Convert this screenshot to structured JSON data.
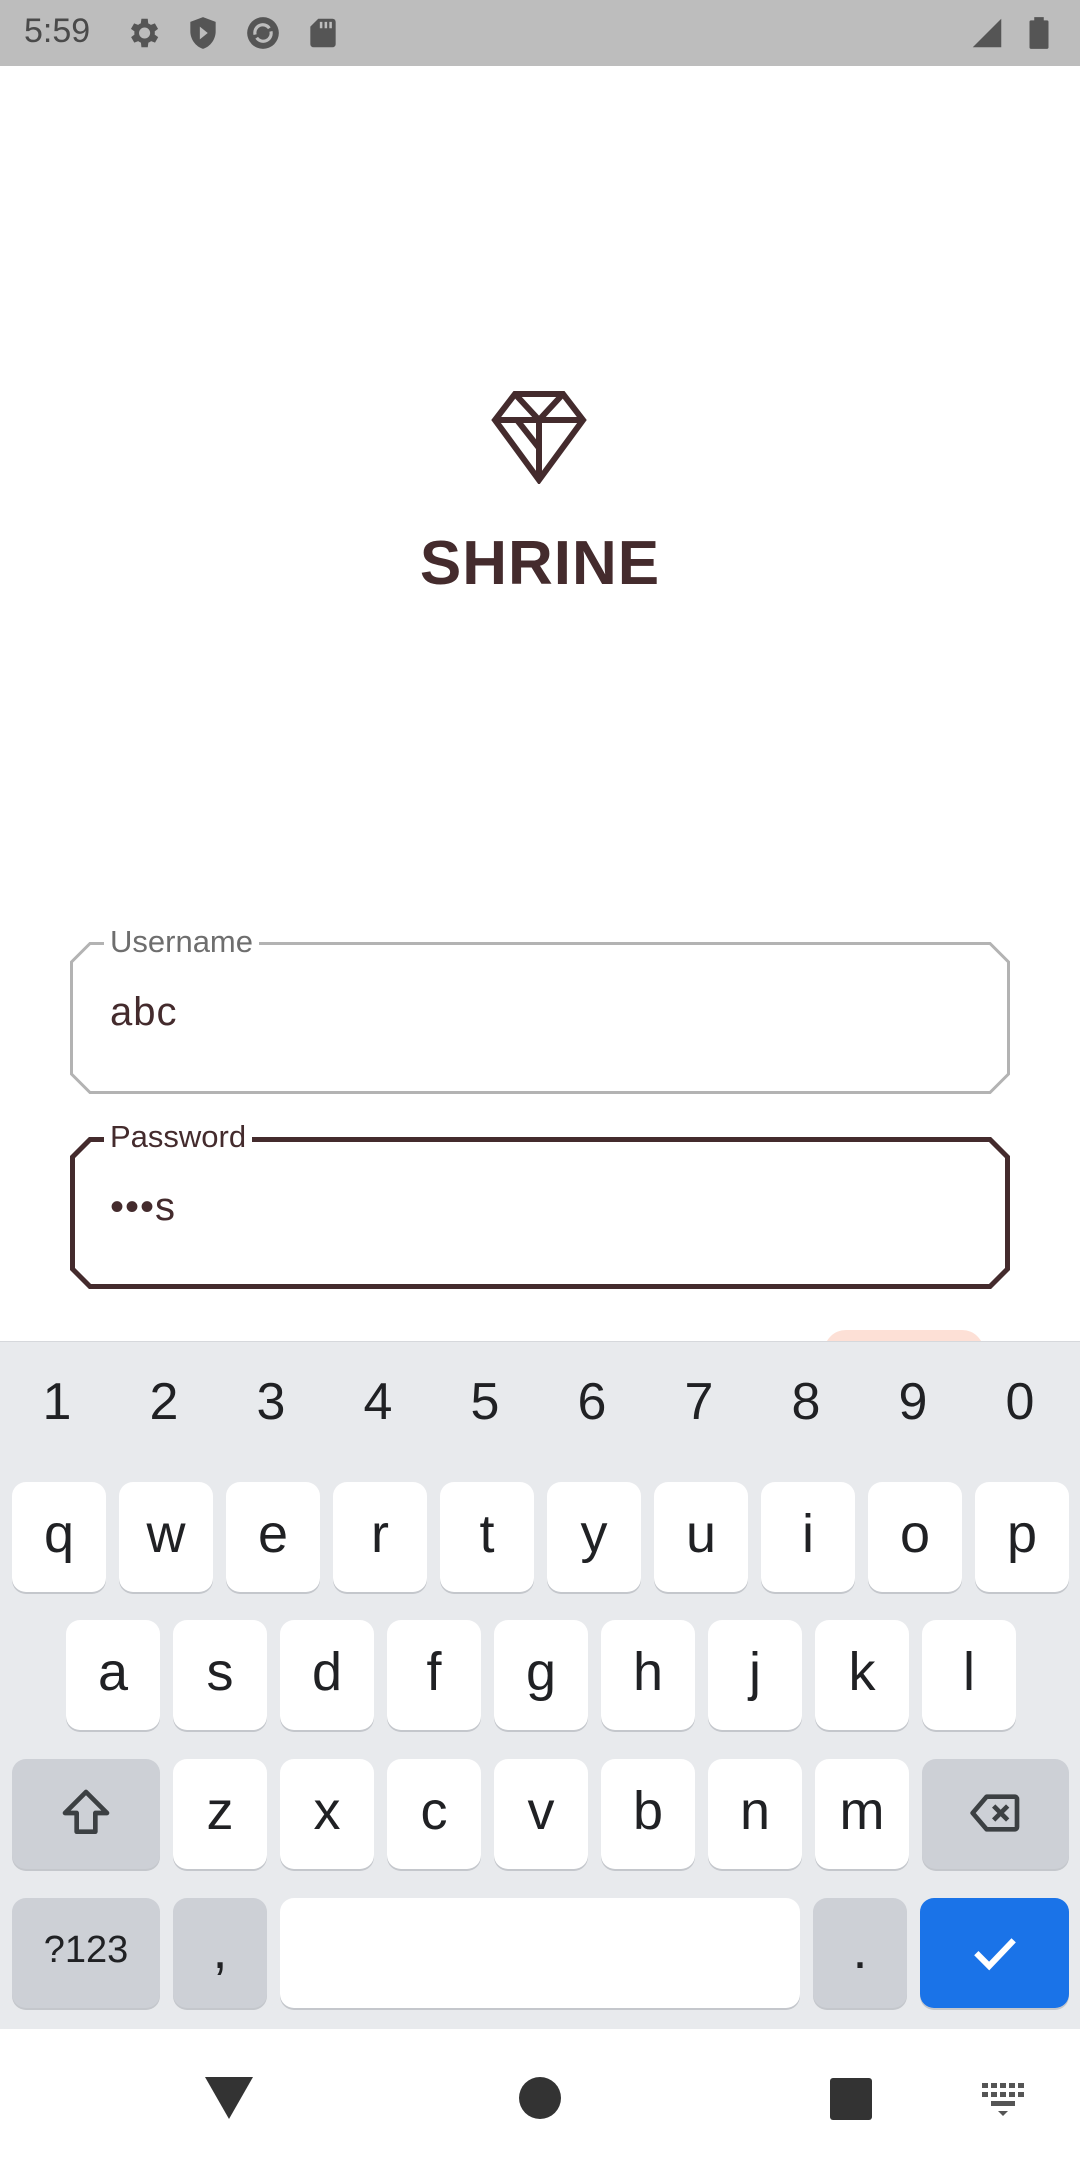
{
  "status_bar": {
    "time": "5:59",
    "icons_left": [
      "settings-icon",
      "shield-icon",
      "sync-icon",
      "sd-card-icon"
    ],
    "icons_right": [
      "signal-icon",
      "battery-icon"
    ]
  },
  "app": {
    "brand": "SHRINE",
    "logo": "diamond-logo"
  },
  "form": {
    "username": {
      "label": "Username",
      "value": "abc"
    },
    "password": {
      "label": "Password",
      "value": "•••s"
    }
  },
  "keyboard": {
    "number_row": [
      "1",
      "2",
      "3",
      "4",
      "5",
      "6",
      "7",
      "8",
      "9",
      "0"
    ],
    "row1": [
      "q",
      "w",
      "e",
      "r",
      "t",
      "y",
      "u",
      "i",
      "o",
      "p"
    ],
    "row2": [
      "a",
      "s",
      "d",
      "f",
      "g",
      "h",
      "j",
      "k",
      "l"
    ],
    "row3": [
      "z",
      "x",
      "c",
      "v",
      "b",
      "n",
      "m"
    ],
    "symbols_label": "?123",
    "comma_label": ",",
    "period_label": ".",
    "shift_icon": "shift-icon",
    "backspace_icon": "backspace-icon",
    "enter_icon": "check-icon",
    "accent_color": "#1a73e8"
  },
  "nav_bar": {
    "buttons": [
      "back-icon",
      "home-icon",
      "recents-icon",
      "keyboard-switch-icon"
    ]
  },
  "colors": {
    "brand": "#442b2d",
    "status_bar_bg": "#bdbdbd",
    "keyboard_bg": "#e8eaed"
  }
}
